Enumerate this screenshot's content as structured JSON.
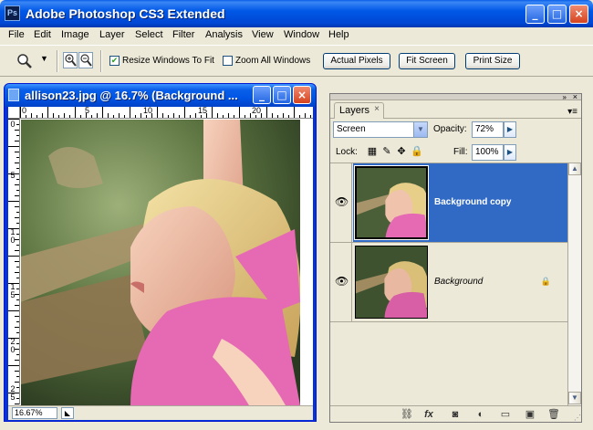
{
  "app": {
    "title": "Adobe Photoshop CS3 Extended",
    "logo_text": "Ps",
    "window_buttons": {
      "minimize": "_",
      "maximize": "□",
      "close": "×"
    }
  },
  "menu": [
    "File",
    "Edit",
    "Image",
    "Layer",
    "Select",
    "Filter",
    "Analysis",
    "View",
    "Window",
    "Help"
  ],
  "options_bar": {
    "tool_icon": "zoom-tool-icon",
    "zoom_in_icon": "zoom-in-icon",
    "zoom_out_icon": "zoom-out-icon",
    "resize_windows_label": "Resize Windows To Fit",
    "resize_windows_checked": true,
    "zoom_all_label": "Zoom All Windows",
    "zoom_all_checked": false,
    "actual_pixels_label": "Actual Pixels",
    "fit_screen_label": "Fit Screen",
    "print_size_label": "Print Size"
  },
  "document": {
    "title": "allison23.jpg @ 16.7% (Background ...",
    "ruler_h_labels": [
      "0",
      "5",
      "10",
      "15",
      "20"
    ],
    "ruler_v_labels": [
      "0",
      "5",
      "10",
      "15",
      "20",
      "25"
    ],
    "zoom_value": "16.67%"
  },
  "layers_panel": {
    "tab_label": "Layers",
    "tab_close": "×",
    "panel_menu_icon": "panel-menu-icon",
    "blend_mode": "Screen",
    "opacity_label": "Opacity:",
    "opacity_value": "72%",
    "lock_label": "Lock:",
    "fill_label": "Fill:",
    "fill_value": "100%",
    "layers": [
      {
        "name": "Background copy",
        "visible": true,
        "selected": true,
        "locked": false
      },
      {
        "name": "Background",
        "visible": true,
        "selected": false,
        "locked": true
      }
    ],
    "bottom_icons": [
      "link-icon",
      "fx-icon",
      "mask-icon",
      "adjustment-icon",
      "group-icon",
      "new-layer-icon",
      "trash-icon"
    ]
  },
  "colors": {
    "selection": "#316ac5",
    "titlebar": "#0055e5",
    "shirt": "#e56ab3"
  }
}
